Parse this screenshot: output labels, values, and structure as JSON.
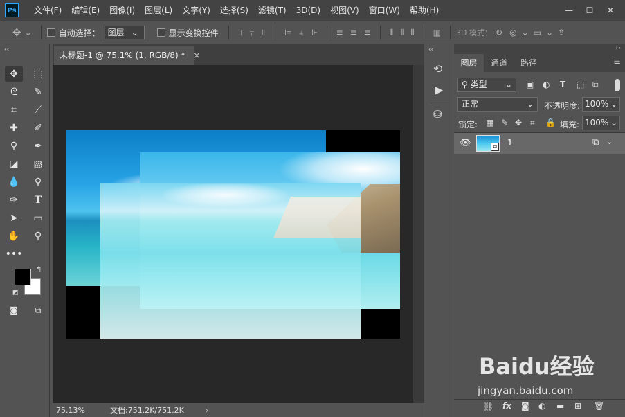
{
  "app": {
    "logo": "Ps",
    "name": "Adobe Photoshop"
  },
  "menus": [
    "文件(F)",
    "编辑(E)",
    "图像(I)",
    "图层(L)",
    "文字(Y)",
    "选择(S)",
    "滤镜(T)",
    "3D(D)",
    "视图(V)",
    "窗口(W)",
    "帮助(H)"
  ],
  "window_controls": {
    "minimize": "—",
    "restore": "☐",
    "close": "✕"
  },
  "options": {
    "auto_select_label": "自动选择：",
    "auto_select_value": "图层",
    "show_transform_label": "显示变换控件",
    "mode_3d_label": "3D 模式："
  },
  "document": {
    "tab_title": "未标题-1 @ 75.1% (1, RGB/8) *",
    "close_symbol": "×",
    "zoom": "75.13%",
    "doc_size": "文档:751.2K/751.2K"
  },
  "panel": {
    "tabs": [
      "图层",
      "通道",
      "路径"
    ],
    "kind_filter": "类型",
    "blend_mode": "正常",
    "opacity_label": "不透明度:",
    "opacity_value": "100%",
    "lock_label": "锁定:",
    "fill_label": "填充:",
    "fill_value": "100%"
  },
  "layers": [
    {
      "name": "1",
      "visible": true,
      "selected": true
    }
  ],
  "footer_icons": [
    "link-icon",
    "fx-icon",
    "mask-icon",
    "adjustment-icon",
    "group-folder-icon",
    "new-layer-icon",
    "trash-icon"
  ],
  "watermark": {
    "brand": "Baidu经验",
    "url": "jingyan.baidu.com"
  },
  "colors": {
    "menubar": "#434343",
    "panel": "#535353",
    "canvas_bg": "#282828",
    "selected_layer": "#686868",
    "accent": "#31a8ff"
  }
}
